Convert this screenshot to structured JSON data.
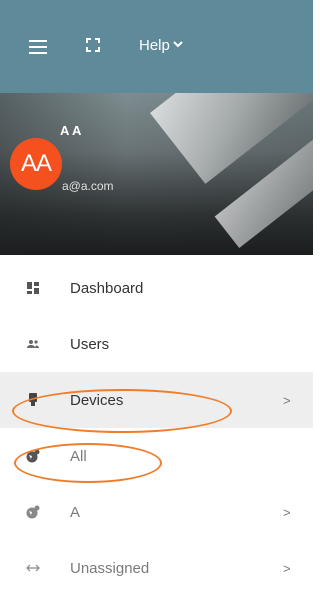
{
  "topbar": {
    "menu_icon": "hamburger-icon",
    "fullscreen_icon": "fullscreen-icon",
    "help_label": "Help"
  },
  "profile": {
    "avatar_initials": "AA",
    "name": "A A",
    "email": "a@a.com"
  },
  "nav": {
    "items": [
      {
        "label": "Dashboard",
        "icon": "dashboard-icon"
      },
      {
        "label": "Users",
        "icon": "users-icon"
      },
      {
        "label": "Devices",
        "icon": "device-icon",
        "arrow": ">"
      },
      {
        "label": "All",
        "icon": "globe-icon"
      },
      {
        "label": "A",
        "icon": "globe-icon",
        "arrow": ">"
      },
      {
        "label": "Unassigned",
        "icon": "unassigned-icon",
        "arrow": ">"
      }
    ]
  },
  "colors": {
    "topbar": "#5f8a9a",
    "avatar": "#f4511e",
    "annotation": "#f07d2b"
  }
}
